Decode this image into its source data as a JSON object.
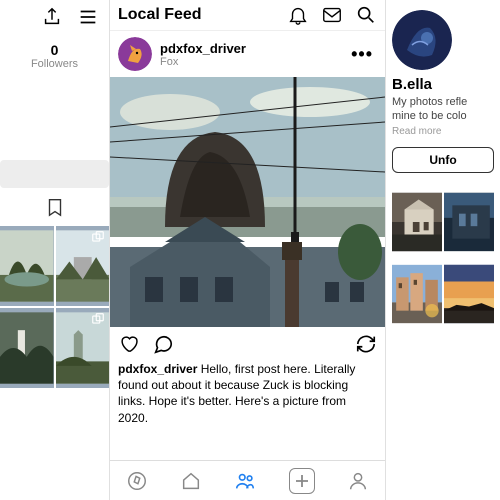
{
  "colA": {
    "stat": {
      "count": "0",
      "label": "Followers"
    }
  },
  "colB": {
    "title": "Local Feed",
    "post": {
      "username": "pdxfox_driver",
      "subtitle": "Fox",
      "caption_user": "pdxfox_driver",
      "caption": " Hello, first post here. Literally found out about it because Zuck is blocking links. Hope it's better. Here's a picture from 2020."
    }
  },
  "colC": {
    "name": "B.ella",
    "bio": "My photos refle\nmine to be colo",
    "read_more": "Read more",
    "button": "Unfo"
  }
}
